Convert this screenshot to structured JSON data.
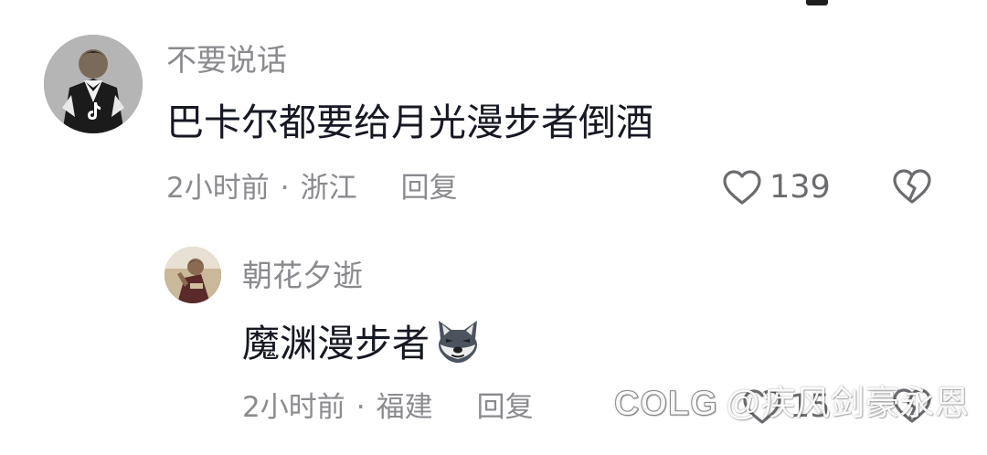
{
  "comments": [
    {
      "username": "不要说话",
      "text": "巴卡尔都要给月光漫步者倒酒",
      "time": "2小时前",
      "separator": "·",
      "location": "浙江",
      "reply_label": "回复",
      "like_count": "139"
    },
    {
      "username": "朝花夕逝",
      "text": "魔渊漫步者",
      "emoji": "wolf-face-emoji",
      "time": "2小时前",
      "separator": "·",
      "location": "福建",
      "reply_label": "回复",
      "like_count": "15"
    }
  ],
  "watermark": {
    "logo": "COLG",
    "text": "@疾风剑豪永恩"
  },
  "icons": {
    "like": "heart-outline-icon",
    "dislike": "broken-heart-icon"
  },
  "colors": {
    "text_primary": "#161823",
    "text_secondary": "#8a8a8f"
  }
}
